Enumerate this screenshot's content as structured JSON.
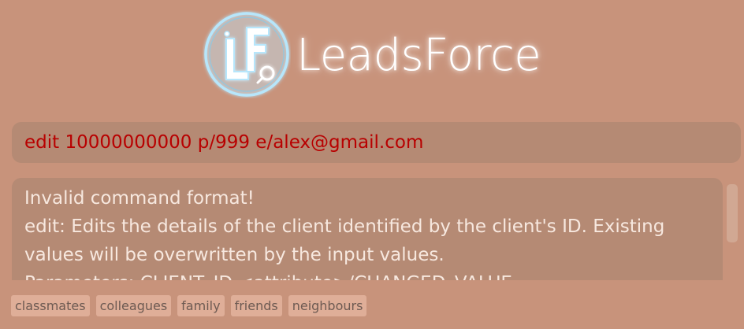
{
  "app": {
    "name": "LeadsForce",
    "logo_letters": "LF"
  },
  "colors": {
    "background": "#c8937b",
    "panel": "#b58a74",
    "command_text": "#b80000",
    "result_text": "#f7e8df",
    "tag_bg": "#dfae98",
    "tag_text": "#6d5a52"
  },
  "command": {
    "value": "edit 10000000000 p/999 e/alex@gmail.com"
  },
  "result": {
    "lines": [
      "Invalid command format!",
      "edit: Edits the details of the client identified by the client's ID. Existing",
      "values will be overwritten by the input values.",
      "Parameters: CLIENT_ID <attribute>/CHANGED_VALUE..."
    ]
  },
  "tags": [
    "classmates",
    "colleagues",
    "family",
    "friends",
    "neighbours"
  ]
}
